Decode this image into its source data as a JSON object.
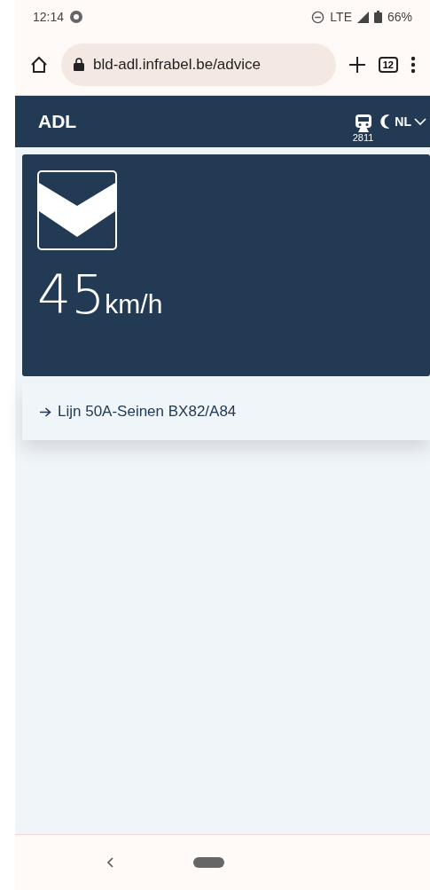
{
  "status_bar": {
    "time": "12:14",
    "network": "LTE",
    "battery": "66%"
  },
  "browser": {
    "url": "bld-adl.infrabel.be/advice",
    "tab_count": "12"
  },
  "header": {
    "title": "ADL",
    "train_number": "2811",
    "language": "NL"
  },
  "advice": {
    "speed": "45",
    "unit": "km/h"
  },
  "route": {
    "text": "Lijn 50A-Seinen BX82/A84"
  }
}
